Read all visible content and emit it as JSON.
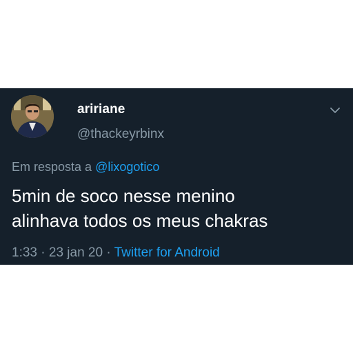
{
  "tweet": {
    "display_name": "aririane",
    "handle": "@thackeyrbinx",
    "reply_prefix": "Em resposta a ",
    "reply_mention": "@lixogotico",
    "text_line1": "5min de soco nesse menino",
    "text_line2": "alinhava todos os meus chakras",
    "time": "1:33",
    "date": "23 jan 20",
    "separator": " · ",
    "source": "Twitter for Android",
    "colors": {
      "background": "#15202b",
      "text": "#ffffff",
      "muted": "#8899a6",
      "link": "#1da1f2"
    },
    "icons": {
      "menu": "chevron-down-icon",
      "avatar": "user-avatar"
    }
  }
}
